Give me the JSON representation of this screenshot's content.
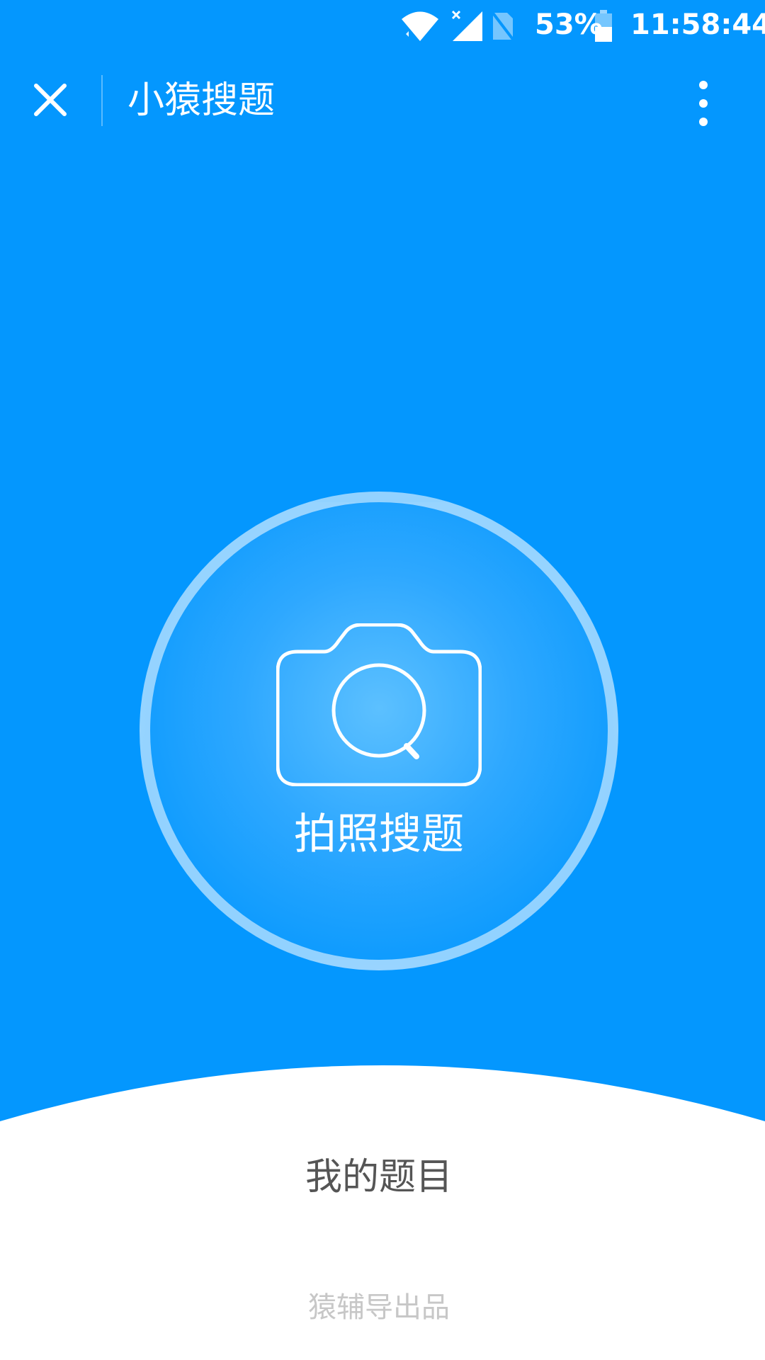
{
  "status_bar": {
    "battery_percent": "53%",
    "time": "11:58:44",
    "icons": [
      "wifi-icon",
      "signal-icon",
      "no-sim-icon",
      "battery-icon"
    ]
  },
  "header": {
    "title": "小猿搜题",
    "close_icon": "close-icon",
    "more_icon": "more-vertical-icon"
  },
  "main": {
    "camera_label": "拍照搜题",
    "camera_icon": "camera-search-icon",
    "my_questions": "我的题目",
    "footer": "猿辅导出品"
  },
  "colors": {
    "primary_blue": "#0497FE",
    "ring": "#9CD4FF",
    "text_gray": "#555555",
    "footer_gray": "#C7C7C7"
  }
}
